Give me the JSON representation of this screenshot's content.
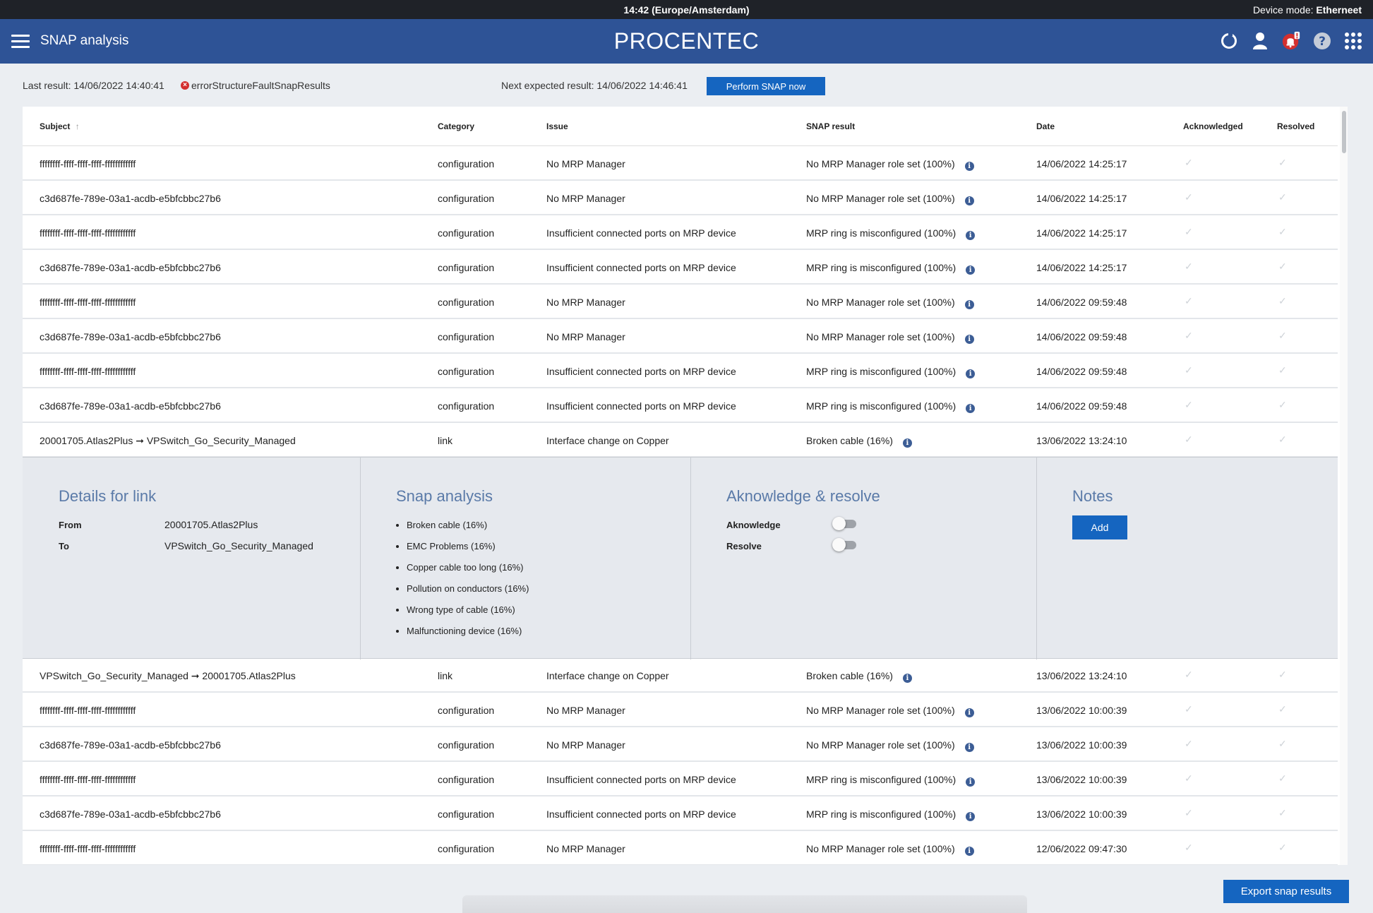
{
  "system_bar": {
    "clock": "14:42 (Europe/Amsterdam)",
    "mode_label": "Device mode:",
    "mode_value": "Etherneet"
  },
  "app_bar": {
    "title": "SNAP analysis",
    "brand": "PROCENTEC",
    "icons": [
      "refresh-icon",
      "user-icon",
      "notifications-icon",
      "help-icon",
      "apps-icon"
    ],
    "accent_color": "#2e5396"
  },
  "status": {
    "last_result": "Last result: 14/06/2022 14:40:41",
    "error": "errorStructureFaultSnapResults",
    "next_expected": "Next expected result: 14/06/2022 14:46:41",
    "perform_button": "Perform SNAP now"
  },
  "table": {
    "headers": {
      "subject": "Subject",
      "category": "Category",
      "issue": "Issue",
      "snap_result": "SNAP result",
      "date": "Date",
      "acknowledged": "Acknowledged",
      "resolved": "Resolved"
    },
    "rows_before": [
      {
        "subject": "ffffffff-ffff-ffff-ffff-ffffffffffff",
        "category": "configuration",
        "issue": "No MRP Manager",
        "snap_result": "No MRP Manager role set (100%)",
        "date": "14/06/2022 14:25:17"
      },
      {
        "subject": "c3d687fe-789e-03a1-acdb-e5bfcbbc27b6",
        "category": "configuration",
        "issue": "No MRP Manager",
        "snap_result": "No MRP Manager role set (100%)",
        "date": "14/06/2022 14:25:17"
      },
      {
        "subject": "ffffffff-ffff-ffff-ffff-ffffffffffff",
        "category": "configuration",
        "issue": "Insufficient connected ports on MRP device",
        "snap_result": "MRP ring is misconfigured (100%)",
        "date": "14/06/2022 14:25:17"
      },
      {
        "subject": "c3d687fe-789e-03a1-acdb-e5bfcbbc27b6",
        "category": "configuration",
        "issue": "Insufficient connected ports on MRP device",
        "snap_result": "MRP ring is misconfigured (100%)",
        "date": "14/06/2022 14:25:17"
      },
      {
        "subject": "ffffffff-ffff-ffff-ffff-ffffffffffff",
        "category": "configuration",
        "issue": "No MRP Manager",
        "snap_result": "No MRP Manager role set (100%)",
        "date": "14/06/2022 09:59:48"
      },
      {
        "subject": "c3d687fe-789e-03a1-acdb-e5bfcbbc27b6",
        "category": "configuration",
        "issue": "No MRP Manager",
        "snap_result": "No MRP Manager role set (100%)",
        "date": "14/06/2022 09:59:48"
      },
      {
        "subject": "ffffffff-ffff-ffff-ffff-ffffffffffff",
        "category": "configuration",
        "issue": "Insufficient connected ports on MRP device",
        "snap_result": "MRP ring is misconfigured (100%)",
        "date": "14/06/2022 09:59:48"
      },
      {
        "subject": "c3d687fe-789e-03a1-acdb-e5bfcbbc27b6",
        "category": "configuration",
        "issue": "Insufficient connected ports on MRP device",
        "snap_result": "MRP ring is misconfigured (100%)",
        "date": "14/06/2022 09:59:48"
      },
      {
        "subject": "20001705.Atlas2Plus ➞ VPSwitch_Go_Security_Managed",
        "category": "link",
        "issue": "Interface change on Copper",
        "snap_result": "Broken cable (16%)",
        "date": "13/06/2022 13:24:10"
      }
    ],
    "rows_after": [
      {
        "subject": "VPSwitch_Go_Security_Managed ➞ 20001705.Atlas2Plus",
        "category": "link",
        "issue": "Interface change on Copper",
        "snap_result": "Broken cable (16%)",
        "date": "13/06/2022 13:24:10"
      },
      {
        "subject": "ffffffff-ffff-ffff-ffff-ffffffffffff",
        "category": "configuration",
        "issue": "No MRP Manager",
        "snap_result": "No MRP Manager role set (100%)",
        "date": "13/06/2022 10:00:39"
      },
      {
        "subject": "c3d687fe-789e-03a1-acdb-e5bfcbbc27b6",
        "category": "configuration",
        "issue": "No MRP Manager",
        "snap_result": "No MRP Manager role set (100%)",
        "date": "13/06/2022 10:00:39"
      },
      {
        "subject": "ffffffff-ffff-ffff-ffff-ffffffffffff",
        "category": "configuration",
        "issue": "Insufficient connected ports on MRP device",
        "snap_result": "MRP ring is misconfigured (100%)",
        "date": "13/06/2022 10:00:39"
      },
      {
        "subject": "c3d687fe-789e-03a1-acdb-e5bfcbbc27b6",
        "category": "configuration",
        "issue": "Insufficient connected ports on MRP device",
        "snap_result": "MRP ring is misconfigured (100%)",
        "date": "13/06/2022 10:00:39"
      },
      {
        "subject": "ffffffff-ffff-ffff-ffff-ffffffffffff",
        "category": "configuration",
        "issue": "No MRP Manager",
        "snap_result": "No MRP Manager role set (100%)",
        "date": "12/06/2022 09:47:30"
      }
    ]
  },
  "details": {
    "link": {
      "title": "Details for link",
      "from_label": "From",
      "from_value": "20001705.Atlas2Plus",
      "to_label": "To",
      "to_value": "VPSwitch_Go_Security_Managed"
    },
    "snap": {
      "title": "Snap analysis",
      "items": [
        "Broken cable (16%)",
        "EMC Problems (16%)",
        "Copper cable too long (16%)",
        "Pollution on conductors (16%)",
        "Wrong type of cable (16%)",
        "Malfunctioning device (16%)"
      ]
    },
    "ack": {
      "title": "Aknowledge & resolve",
      "acknowledge_label": "Aknowledge",
      "resolve_label": "Resolve",
      "acknowledge_on": false,
      "resolve_on": false
    },
    "notes": {
      "title": "Notes",
      "add_button": "Add"
    }
  },
  "footer": {
    "export_button": "Export snap results"
  }
}
